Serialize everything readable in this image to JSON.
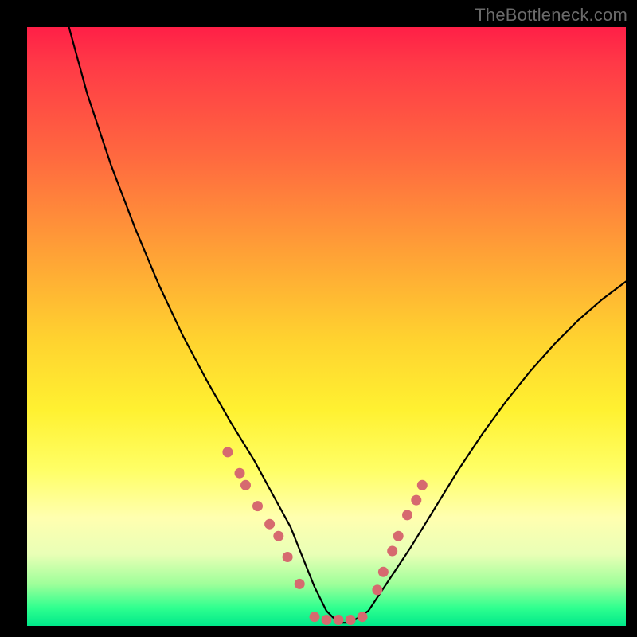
{
  "watermark": "TheBottleneck.com",
  "chart_data": {
    "type": "line",
    "title": "",
    "xlabel": "",
    "ylabel": "",
    "xlim": [
      0,
      100
    ],
    "ylim": [
      0,
      100
    ],
    "series": [
      {
        "name": "curve",
        "x": [
          7,
          10,
          14,
          18,
          22,
          26,
          30,
          34,
          38,
          41,
          44,
          46,
          48,
          50,
          52,
          54,
          57,
          60,
          64,
          68,
          72,
          76,
          80,
          84,
          88,
          92,
          96,
          100
        ],
        "values": [
          100,
          89,
          77,
          66.5,
          57,
          48.5,
          41,
          34,
          27.5,
          22,
          16.5,
          11.5,
          6.5,
          2.5,
          0.5,
          0.5,
          2.5,
          7,
          13,
          19.5,
          26,
          32,
          37.5,
          42.5,
          47,
          51,
          54.5,
          57.5
        ]
      }
    ],
    "dots": {
      "name": "markers",
      "color": "#d66a6f",
      "x": [
        33.5,
        35.5,
        36.5,
        38.5,
        40.5,
        42.0,
        43.5,
        45.5,
        48.0,
        50.0,
        52.0,
        54.0,
        56.0,
        58.5,
        59.5,
        61.0,
        62.0,
        63.5,
        65.0,
        66.0
      ],
      "values": [
        29.0,
        25.5,
        23.5,
        20.0,
        17.0,
        15.0,
        11.5,
        7.0,
        1.5,
        1.0,
        1.0,
        1.0,
        1.5,
        6.0,
        9.0,
        12.5,
        15.0,
        18.5,
        21.0,
        23.5
      ]
    },
    "gradient_stops": [
      {
        "pos": 0,
        "color": "#ff1f47"
      },
      {
        "pos": 22,
        "color": "#ff6a3f"
      },
      {
        "pos": 52,
        "color": "#ffd22f"
      },
      {
        "pos": 74,
        "color": "#ffff66"
      },
      {
        "pos": 93,
        "color": "#9fff9a"
      },
      {
        "pos": 100,
        "color": "#00e98a"
      }
    ]
  }
}
